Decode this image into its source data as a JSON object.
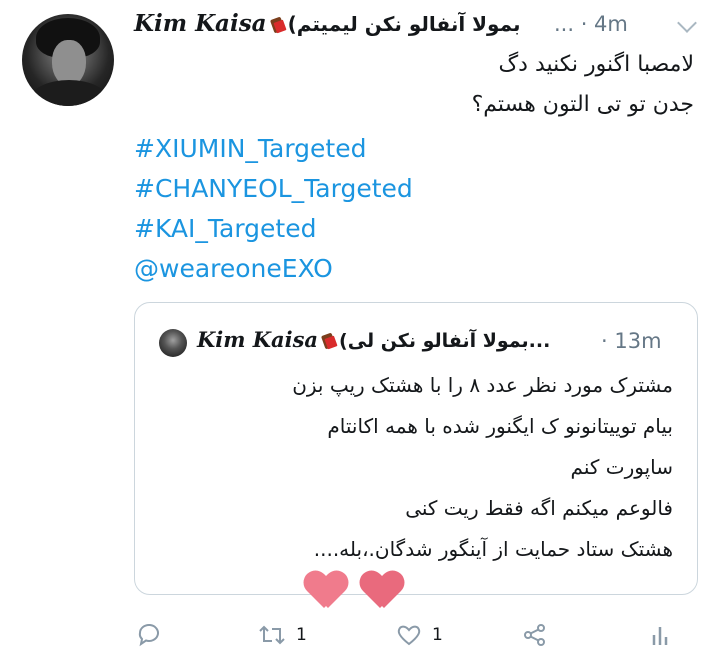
{
  "tweet": {
    "author_name": "Kim Kaisa",
    "author_suffix": "(بمولا آنفالو نکن لیمیتم",
    "meta": "... · 4m",
    "body_lines": [
      "لامصبا اگنور نکنید دگ",
      "جدن تو تی التون هستم؟"
    ],
    "hashtags": [
      "#XIUMIN_Targeted",
      "#CHANYEOL_Targeted",
      "#KAI_Targeted",
      "@weareoneEXO"
    ]
  },
  "quoted": {
    "author_name": "Kim Kaisa",
    "author_suffix": "(بمولا آنفالو نکن لی...",
    "time": "· 13m",
    "lines": [
      "مشترک مورد نظر عدد ۸ را با هشتک ریپ بزن",
      "بیام توییتانونو ک ایگنور شده با همه اکانتام",
      "ساپورت کنم",
      "فالوعم میکنم اگه فقط ریت کنی",
      "هشتک ستاد حمایت از آینگور شدگان.،بله...."
    ]
  },
  "actions": {
    "reply_icon": "reply-icon",
    "retweet_icon": "retweet-icon",
    "retweet_count": "1",
    "like_icon": "heart-icon",
    "like_count": "1",
    "share_icon": "share-icon",
    "analytics_icon": "analytics-icon"
  },
  "colors": {
    "link": "#1b95e0",
    "muted": "#657786",
    "border": "#ccd6dd",
    "heart_sticker": "#f07b8c"
  }
}
